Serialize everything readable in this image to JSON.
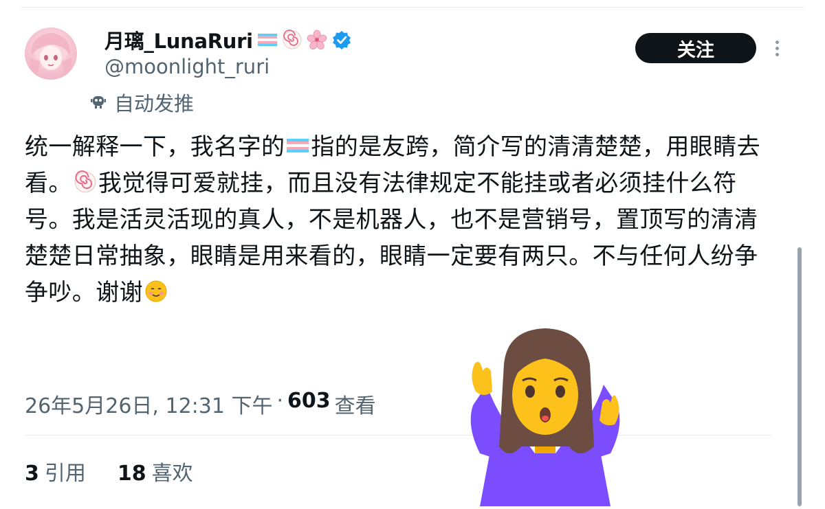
{
  "user": {
    "display_name": "月璃_LunaRuri",
    "handle": "@moonlight_ruri",
    "automated_label": "自动发推",
    "name_emojis": [
      "transgender-flag-emoji",
      "naruto-fishcake-emoji",
      "cherry-blossom-emoji"
    ],
    "verified": true
  },
  "actions": {
    "follow_label": "关注"
  },
  "tweet": {
    "text_part1": "统一解释一下，我名字的",
    "text_part2": "指的是友跨，简介写的清清楚楚，用眼睛去看。",
    "text_part3": "我觉得可爱就挂，而且没有法律规定不能挂或者必须挂什么符号。我是活灵活现的真人，不是机器人，也不是营销号，置顶写的清清楚楚日常抽象，眼睛是用来看的，眼睛一定要有两只。不与任何人纷争争吵。谢谢",
    "timestamp": "26年5月26日, 12:31 下午",
    "separator": "·",
    "views_count": "603",
    "views_label": "查看"
  },
  "stats": {
    "quotes_count": "3",
    "quotes_label": "引用",
    "likes_count": "18",
    "likes_label": "喜欢"
  },
  "overlay": {
    "icon": "woman-shrugging-emoji"
  },
  "colors": {
    "text_primary": "#0f1419",
    "text_secondary": "#536471",
    "verified_blue": "#1d9bf0",
    "follow_bg": "#0f1419",
    "trans_blue": "#5bcefa",
    "trans_pink": "#f5a9b8"
  }
}
